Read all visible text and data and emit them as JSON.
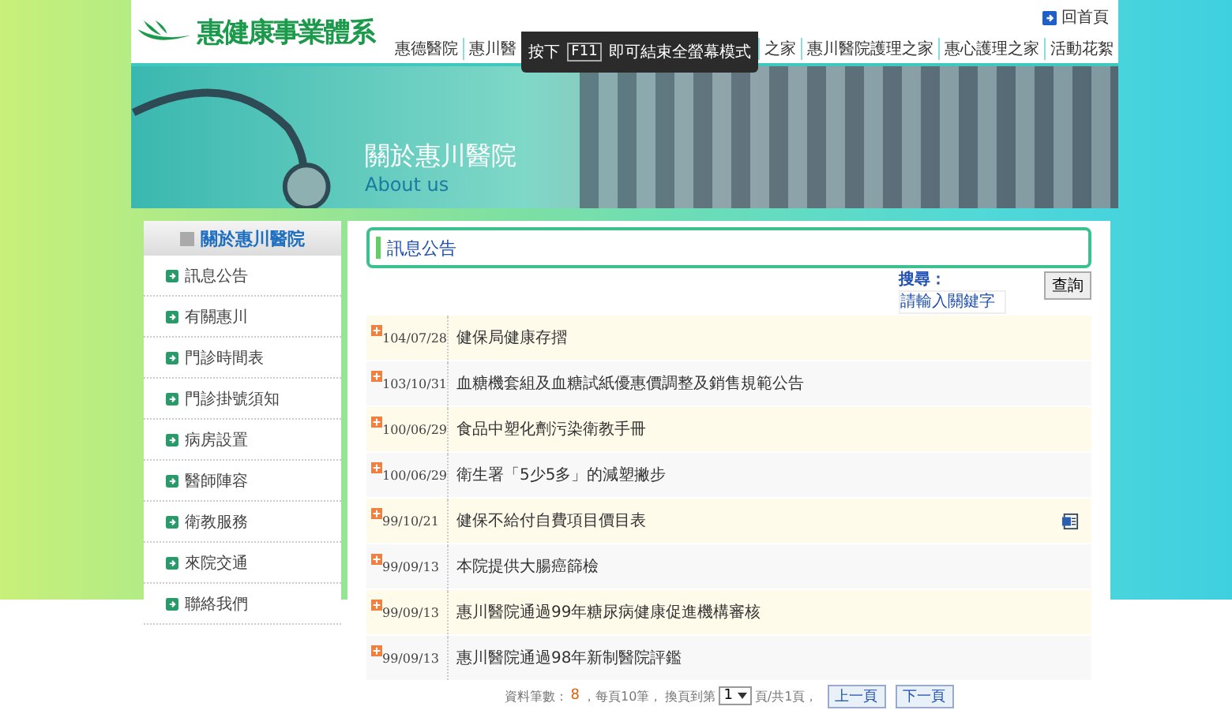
{
  "header": {
    "logo": "惠健康事業體系",
    "home_link": "回首頁",
    "nav": [
      {
        "label": "惠德醫院"
      },
      {
        "label": "惠川醫"
      },
      {
        "label": "之家"
      },
      {
        "label": "惠川醫院護理之家"
      },
      {
        "label": "惠心護理之家"
      },
      {
        "label": "活動花絮"
      }
    ],
    "fullscreen_toast": {
      "before": "按下",
      "key": "F11",
      "after": "即可結束全螢幕模式"
    }
  },
  "banner": {
    "title": "關於惠川醫院",
    "subtitle": "About us"
  },
  "sidebar": {
    "title": "關於惠川醫院",
    "items": [
      {
        "label": "訊息公告"
      },
      {
        "label": "有關惠川"
      },
      {
        "label": "門診時間表"
      },
      {
        "label": "門診掛號須知"
      },
      {
        "label": "病房設置"
      },
      {
        "label": "醫師陣容"
      },
      {
        "label": "衛教服務"
      },
      {
        "label": "來院交通"
      },
      {
        "label": "聯絡我們"
      }
    ]
  },
  "content": {
    "title": "訊息公告",
    "search": {
      "label": "搜尋：",
      "placeholder": "請輸入關鍵字",
      "button": "查詢"
    },
    "rows": [
      {
        "date": "104/07/28",
        "title": "健保局健康存摺",
        "attachment": false
      },
      {
        "date": "103/10/31",
        "title": "血糖機套組及血糖試紙優惠價調整及銷售規範公告",
        "attachment": false
      },
      {
        "date": "100/06/29",
        "title": "食品中塑化劑污染衛教手冊",
        "attachment": false
      },
      {
        "date": "100/06/29",
        "title": "衛生署「5少5多」的減塑撇步",
        "attachment": false
      },
      {
        "date": "99/10/21",
        "title": "健保不給付自費項目價目表",
        "attachment": true
      },
      {
        "date": "99/09/13",
        "title": "本院提供大腸癌篩檢",
        "attachment": false
      },
      {
        "date": "99/09/13",
        "title": "惠川醫院通過99年糖尿病健康促進機構審核",
        "attachment": false
      },
      {
        "date": "99/09/13",
        "title": "惠川醫院通過98年新制醫院評鑑",
        "attachment": false
      }
    ],
    "pagination": {
      "count_label": "資料筆數：",
      "count": "8",
      "per_page": "，每頁10筆，",
      "goto_label": "換頁到第",
      "page": "1",
      "total": "頁/共1頁，",
      "prev": "上一頁",
      "next": "下一頁"
    }
  }
}
